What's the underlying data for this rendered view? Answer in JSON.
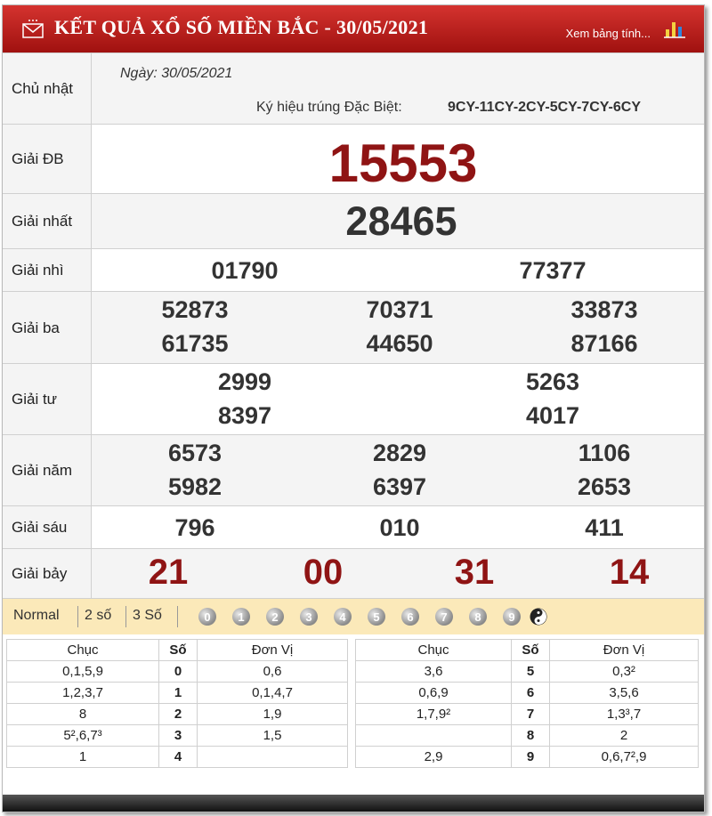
{
  "header": {
    "title": "KẾT QUẢ XỔ SỐ MIỀN BẮC - 30/05/2021",
    "link": "Xem bảng tính...",
    "brand_color": "#b31b18"
  },
  "info": {
    "weekday": "Chủ nhật",
    "date": "Ngày: 30/05/2021",
    "code_label": "Ký hiệu trúng Đặc Biệt:",
    "code_value": "9CY-11CY-2CY-5CY-7CY-6CY"
  },
  "prizes": {
    "db": {
      "label": "Giải ĐB",
      "numbers": [
        "15553"
      ]
    },
    "nhat": {
      "label": "Giải nhất",
      "numbers": [
        "28465"
      ]
    },
    "nhi": {
      "label": "Giải nhì",
      "numbers": [
        "01790",
        "77377"
      ]
    },
    "ba": {
      "label": "Giải ba",
      "numbers": [
        "52873",
        "70371",
        "33873",
        "61735",
        "44650",
        "87166"
      ]
    },
    "tu": {
      "label": "Giải tư",
      "numbers": [
        "2999",
        "5263",
        "8397",
        "4017"
      ]
    },
    "nam": {
      "label": "Giải năm",
      "numbers": [
        "6573",
        "2829",
        "1106",
        "5982",
        "6397",
        "2653"
      ]
    },
    "sau": {
      "label": "Giải sáu",
      "numbers": [
        "796",
        "010",
        "411"
      ]
    },
    "bay": {
      "label": "Giải bảy",
      "numbers": [
        "21",
        "00",
        "31",
        "14"
      ]
    }
  },
  "toolbar": {
    "modes": [
      "Normal",
      "2 số",
      "3 Số"
    ],
    "digits": [
      "0",
      "1",
      "2",
      "3",
      "4",
      "5",
      "6",
      "7",
      "8",
      "9"
    ]
  },
  "loto": {
    "headers": [
      "Chục",
      "Số",
      "Đơn Vị"
    ],
    "left": [
      {
        "chuc": "0,1,5,9",
        "so": "0",
        "donvi": "0,6"
      },
      {
        "chuc": "1,2,3,7",
        "so": "1",
        "donvi": "0,1,4,7"
      },
      {
        "chuc": "8",
        "so": "2",
        "donvi": "1,9"
      },
      {
        "chuc": "5²,6,7³",
        "so": "3",
        "donvi": "1,5"
      },
      {
        "chuc": "1",
        "so": "4",
        "donvi": ""
      }
    ],
    "right": [
      {
        "chuc": "3,6",
        "so": "5",
        "donvi": "0,3²"
      },
      {
        "chuc": "0,6,9",
        "so": "6",
        "donvi": "3,5,6"
      },
      {
        "chuc": "1,7,9²",
        "so": "7",
        "donvi": "1,3³,7"
      },
      {
        "chuc": "",
        "so": "8",
        "donvi": "2"
      },
      {
        "chuc": "2,9",
        "so": "9",
        "donvi": "0,6,7²,9"
      }
    ]
  }
}
